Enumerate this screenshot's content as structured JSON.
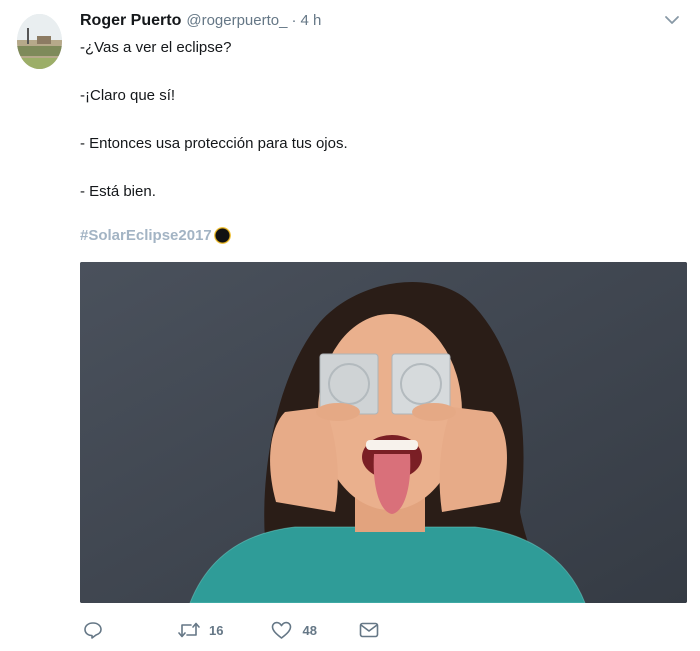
{
  "tweet": {
    "author_name": "Roger Puerto",
    "author_handle": "@rogerpuerto_",
    "separator": "·",
    "timestamp": "4 h",
    "lines": [
      "-¿Vas a ver el eclipse?",
      "-¡Claro que sí!",
      "- Entonces usa protección para tus ojos.",
      "- Está bien."
    ],
    "hashtag": "#SolarEclipse2017",
    "hashtag_emoji": "eclipse-emoji"
  },
  "actions": {
    "reply_icon": "reply-icon",
    "retweet_icon": "retweet-icon",
    "retweet_count": "16",
    "like_icon": "heart-icon",
    "like_count": "48",
    "dm_icon": "envelope-icon"
  },
  "colors": {
    "text": "#14171a",
    "secondary": "#657786",
    "hashtag": "#a3b4c4"
  }
}
